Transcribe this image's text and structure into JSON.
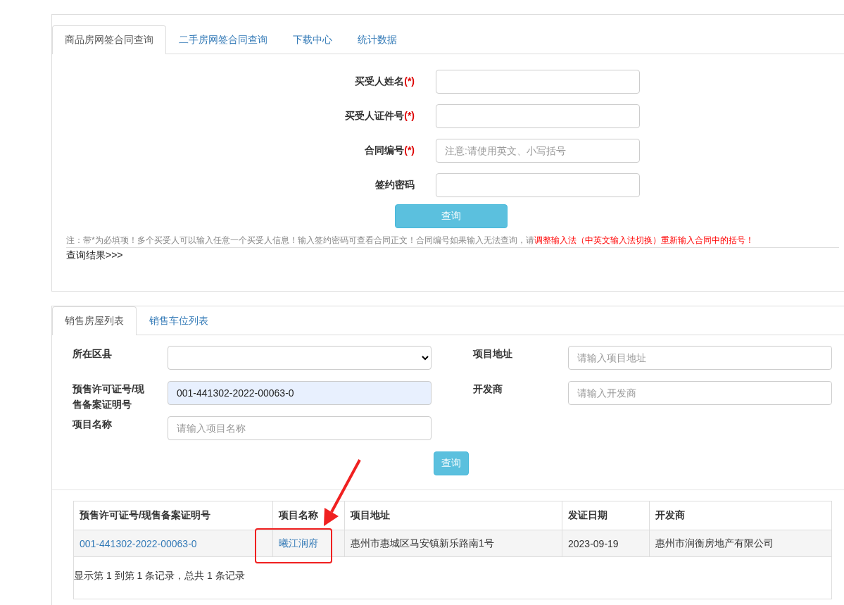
{
  "contract_panel": {
    "tabs": [
      {
        "label": "商品房网签合同查询",
        "selected": true
      },
      {
        "label": "二手房网签合同查询",
        "selected": false
      },
      {
        "label": "下载中心",
        "selected": false
      },
      {
        "label": "统计数据",
        "selected": false
      }
    ],
    "fields": [
      {
        "label": "买受人姓名",
        "required_mark": "(*)"
      },
      {
        "label": "买受人证件号",
        "required_mark": "(*)"
      },
      {
        "label": "合同编号",
        "required_mark": "(*)",
        "placeholder": "注意:请使用英文、小写括号"
      },
      {
        "label": "签约密码"
      }
    ],
    "query_button": "查询",
    "note": {
      "text": "注：带*为必填项！多个买受人可以输入任意一个买受人信息！输入签约密码可查看合同正文！合同编号如果输入无法查询，请",
      "warning": "调整输入法（中英文输入法切换）重新输入合同中的括号！"
    },
    "result_label": "查询结果>>>"
  },
  "sales_panel": {
    "tabs": [
      {
        "label": "销售房屋列表",
        "selected": true
      },
      {
        "label": "销售车位列表",
        "selected": false
      }
    ],
    "filters": [
      {
        "kind": "select",
        "label": "所在区县"
      },
      {
        "kind": "text",
        "label": "项目地址",
        "placeholder": "请输入项目地址"
      },
      {
        "kind": "text",
        "label": "预售许可证号/现售备案证明号",
        "value": "001-441302-2022-00063-0"
      },
      {
        "kind": "text",
        "label": "开发商",
        "placeholder": "请输入开发商"
      },
      {
        "kind": "text",
        "label": "项目名称",
        "placeholder": "请输入项目名称"
      }
    ],
    "query_button": "查询",
    "table": {
      "columns": [
        "预售许可证号/现售备案证明号",
        "项目名称",
        "项目地址",
        "发证日期",
        "开发商"
      ],
      "rows": [
        [
          {
            "text": "001-441302-2022-00063-0",
            "link": true
          },
          {
            "text": "曦江润府",
            "link": true
          },
          {
            "text": "惠州市惠城区马安镇新乐路南1号",
            "link": false
          },
          {
            "text": "2023-09-19",
            "link": false
          },
          {
            "text": "惠州市润衡房地产有限公司",
            "link": false
          }
        ]
      ],
      "footer": "显示第 1 到第 1 条记录，总共 1 条记录"
    }
  }
}
